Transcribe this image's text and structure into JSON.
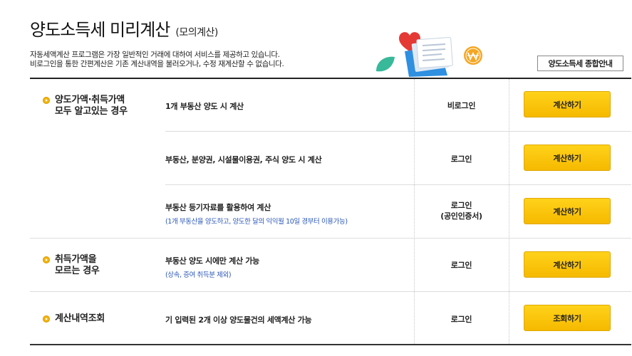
{
  "page": {
    "title": "양도소득세 미리계산",
    "subtitle": "(모의계산)",
    "desc_line1": "자동세액계산 프로그램은 가장 일반적인 거래에 대하여 서비스를 제공하고 있습니다.",
    "desc_line2": "비로그인을 통한 간편계산은 기존 계산내역을 불러오거나, 수정 재계산할 수 없습니다.",
    "guide_button": "양도소득세 종합안내"
  },
  "categories": [
    {
      "line1": "양도가액·취득가액",
      "line2": "모두 알고있는 경우"
    },
    {
      "line1": "취득가액을",
      "line2": "모르는 경우"
    },
    {
      "line1": "계산내역조회",
      "line2": ""
    }
  ],
  "rows": [
    {
      "main": "1개 부동산 양도 시 계산",
      "note": "",
      "login1": "비로그인",
      "login2": "",
      "button": "계산하기"
    },
    {
      "main": "부동산, 분양권, 시설물이용권, 주식 양도 시 계산",
      "note": "",
      "login1": "로그인",
      "login2": "",
      "button": "계산하기"
    },
    {
      "main": "부동산 등기자료를 활용하여 계산",
      "note": "(1개 부동산을 양도하고, 양도한 달의 익익월 10일 경부터 이용가능)",
      "login1": "로그인",
      "login2": "(공인인증서)",
      "button": "계산하기"
    },
    {
      "main": "부동산 양도 시에만 계산 가능",
      "note": "(상속, 증여 취득분 제외)",
      "login1": "로그인",
      "login2": "",
      "button": "계산하기"
    },
    {
      "main": "기 입력된 2개 이상 양도물건의 세액계산 가능",
      "note": "",
      "login1": "로그인",
      "login2": "",
      "button": "조회하기"
    }
  ],
  "colors": {
    "button_yellow": "#f5b900",
    "note_blue": "#2b57b8",
    "bullet_orange": "#f4b400"
  },
  "icons": {
    "illustration": "document-heart-coin-illustration",
    "bullet": "orange-circle-bullet-icon"
  }
}
